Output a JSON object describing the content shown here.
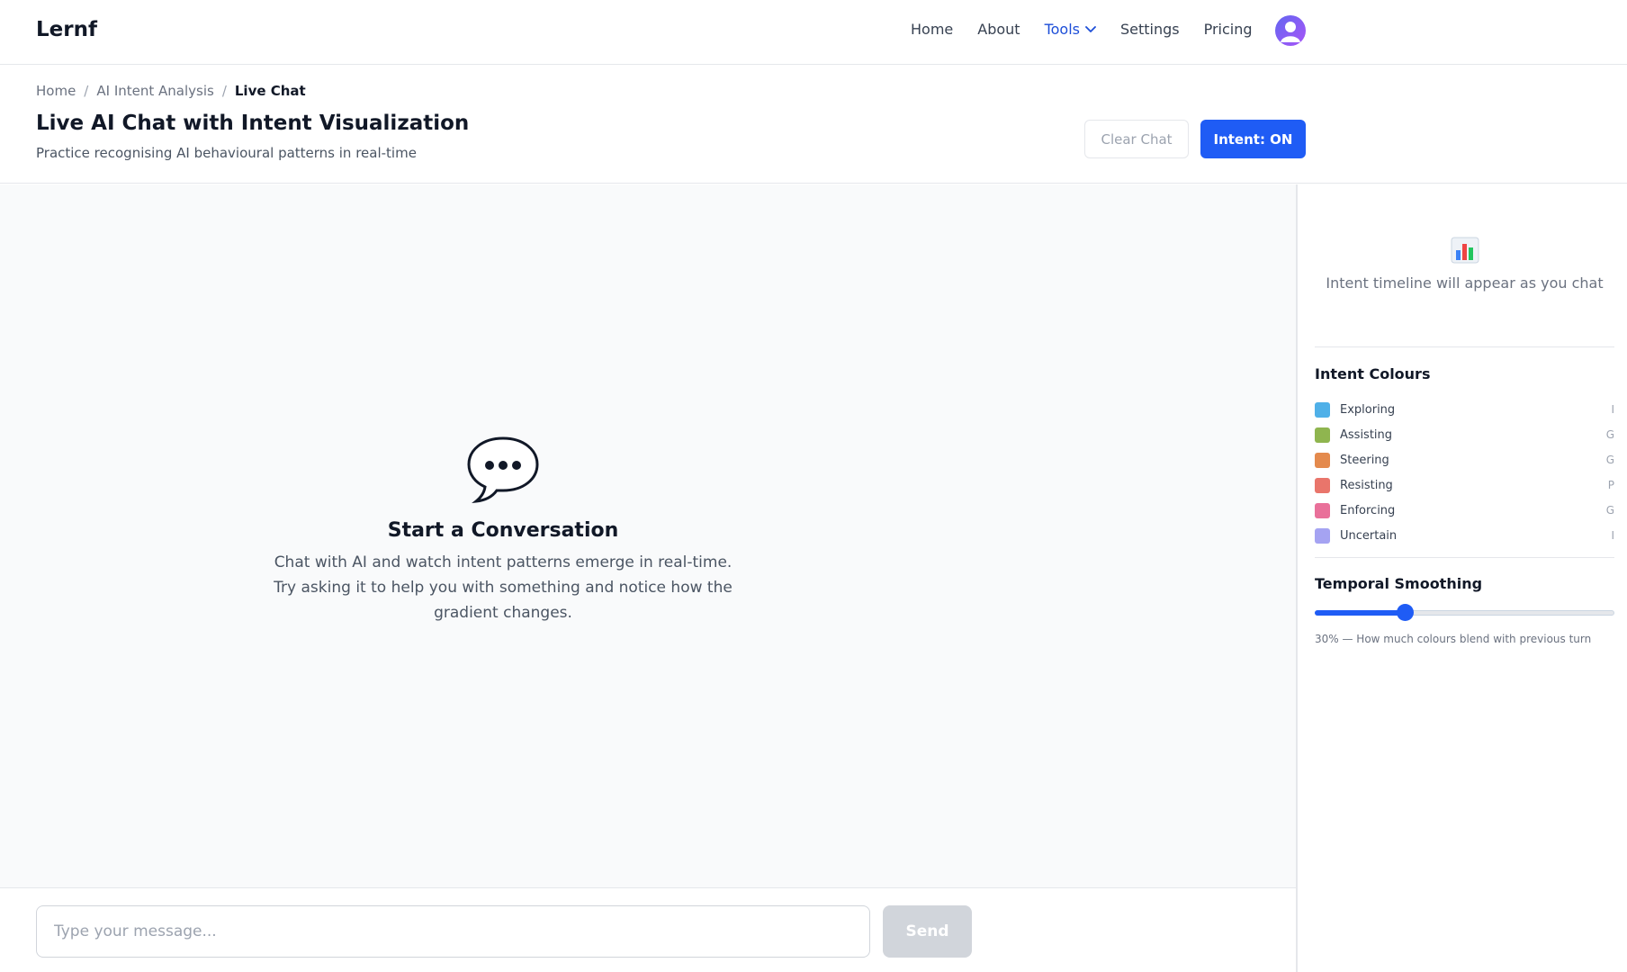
{
  "nav": {
    "logo": "Lernf",
    "links": [
      {
        "label": "Home"
      },
      {
        "label": "About"
      },
      {
        "label": "Tools"
      },
      {
        "label": "Settings"
      },
      {
        "label": "Pricing"
      }
    ],
    "active_link": "Tools",
    "avatar_icon": "user-avatar-icon",
    "accent_color": "#1f5cf5"
  },
  "header": {
    "breadcrumb": [
      "Home",
      "AI Intent Analysis",
      "Live Chat"
    ],
    "title": "Live AI Chat with Intent Visualization",
    "subtitle": "Practice recognising AI behavioural patterns in real-time",
    "clear_label": "Clear Chat",
    "intent_label": "Intent: ON"
  },
  "chat": {
    "empty_icon": "speech-bubble-icon",
    "empty_title": "Start a Conversation",
    "empty_lines": [
      "Chat with AI and watch intent patterns emerge in real-time.",
      "Try asking it to help you with something and notice how the",
      "gradient changes."
    ],
    "input_placeholder": "Type your message...",
    "send_label": "Send"
  },
  "panel": {
    "timeline_icon": "bar-chart-icon",
    "timeline_empty": "Intent timeline will appear as you chat",
    "legend_title": "Intent Colours",
    "legend": [
      {
        "label": "Exploring",
        "color": "#4fb0e8",
        "key": "I"
      },
      {
        "label": "Assisting",
        "color": "#8fb54f",
        "key": "G"
      },
      {
        "label": "Steering",
        "color": "#e48a4d",
        "key": "G"
      },
      {
        "label": "Resisting",
        "color": "#e9756b",
        "key": "P"
      },
      {
        "label": "Enforcing",
        "color": "#e9709a",
        "key": "G"
      },
      {
        "label": "Uncertain",
        "color": "#a5a3f2",
        "key": "I"
      }
    ],
    "smoothing_title": "Temporal Smoothing",
    "smoothing_value": 0.3,
    "smoothing_note": "30% — How much colours blend with previous turn"
  }
}
